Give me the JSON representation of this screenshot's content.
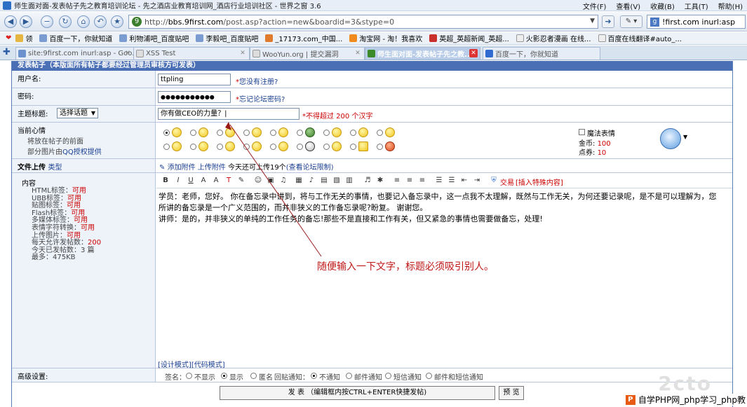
{
  "window": {
    "title": "师生面对面-发表帖子先之教育培训论坛 - 先之酒店业教育培训网_酒店行业培训社区 - 世界之窗 3.6",
    "menu": [
      "文件(F)",
      "查看(V)",
      "收藏(B)",
      "工具(T)",
      "帮助(H)"
    ]
  },
  "navbar": {
    "url_prefix": "http://",
    "url_host": "bbs.9first.com",
    "url_rest": "/post.asp?action=new&boardid=3&stype=0",
    "search_text": "!first.com inurl:asp"
  },
  "bookmarks": [
    "领",
    "百度一下，你就知道",
    "利物浦吧_百度贴吧",
    "李毅吧_百度贴吧",
    "_17173.com_中国...",
    "淘宝网 - 淘！我喜欢",
    "英超_英超新闻_英超...",
    "火影忍者漫画 在线...",
    "百度在线翻译#auto_..."
  ],
  "tabs": [
    {
      "label": "site:9first.com inurl:asp - Goo...",
      "active": false
    },
    {
      "label": "XSS Test",
      "active": false
    },
    {
      "label": "WooYun.org | 提交漏洞",
      "active": false
    },
    {
      "label": "师生面对面-发表帖子先之教...",
      "active": true
    },
    {
      "label": "百度一下，你就知道",
      "active": false
    }
  ],
  "form": {
    "header": "发表帖子（本版面所有帖子都要经过管理员审核方可发表）",
    "username_label": "用户名:",
    "username_value": "ttpling",
    "username_hint_star": "*",
    "username_hint_link": "您没有注册?",
    "password_label": "密码:",
    "password_value": "●●●●●●●●●●●",
    "password_hint_star": "*",
    "password_hint_link": "忘记论坛密码?",
    "subject_label": "主题标题:",
    "subject_select": "选择话题",
    "subject_value": "你有做CEO的力量？|",
    "subject_hint": "*不得超过 200 个汉字",
    "mood_label": "当前心情",
    "mood_sub1": "将放在帖子的前面",
    "mood_sub2": "部分图片由",
    "mood_sub2_link": "QQ授权提供",
    "magic_label": "魔法表情",
    "gold_label": "金币:",
    "gold_value": "100",
    "points_label": "点券:",
    "points_value": "10",
    "upload_label": "文件上传",
    "upload_type": "类型",
    "upload_add": "添加附件",
    "upload_file": "上传附件",
    "upload_today": "今天还可上传19个",
    "upload_limit": "(查看论坛限制)",
    "content_label": "内容",
    "content_meta": [
      {
        "k": "HTML标签：",
        "v": "可用"
      },
      {
        "k": "UBB标签：",
        "v": "可用"
      },
      {
        "k": "贴图标签：",
        "v": "可用"
      },
      {
        "k": "Flash标签：",
        "v": "可用"
      },
      {
        "k": "多媒体标签：",
        "v": "可用"
      },
      {
        "k": "表情字符转换：",
        "v": "可用"
      },
      {
        "k": "上传图片：",
        "v": "可用"
      },
      {
        "k": "每天允许发帖数：",
        "v": "200"
      },
      {
        "k": "今天已发帖数：",
        "v": "3 篇"
      },
      {
        "k": "最多：",
        "v": "475KB"
      }
    ],
    "toolbar_trade": "交易",
    "toolbar_special": "[插入特殊内容]",
    "editor_lines": [
      "学员：老师，您好。  你在备忘录中讲到，将与工作无关的事情，也要记入备忘录中，这一点我不太理解，既然与工作无关，为何还要记录呢，是不是可以理解为，您",
      "所讲的备忘录是一个广义范围的，而并非狭义的工作备忘录呢?盼复。  谢谢您。",
      "讲师：是的，并非狭义的单纯的工作任务的备忘!那些不是直接和工作有关，但又紧急的事情也需要做备忘，处理!"
    ],
    "mode_design": "[设计模式]",
    "mode_code": "[代码模式]",
    "advanced_label": "高级设置:",
    "sign_label": "签名：",
    "sign_opt_none": "不显示",
    "sign_opt_show": "显示",
    "anon_label": "匿名",
    "reply_label": "回贴通知：",
    "reply_opts": [
      "不通知",
      "邮件通知",
      "短信通知",
      "邮件和短信通知"
    ],
    "submit_label": "发 表 （编辑框内按CTRL+ENTER快捷发帖)",
    "preview_label": "预 览"
  },
  "annotation": "随便输入一下文字，标题必须吸引别人。",
  "watermark": {
    "text": "自学PHP网_php学习_php教",
    "logo_text": "P"
  },
  "colors": {
    "header_bg": "#4a6fb4",
    "label_bg": "#eef3fa",
    "annotation": "#c01818",
    "accent_red": "#c00"
  }
}
